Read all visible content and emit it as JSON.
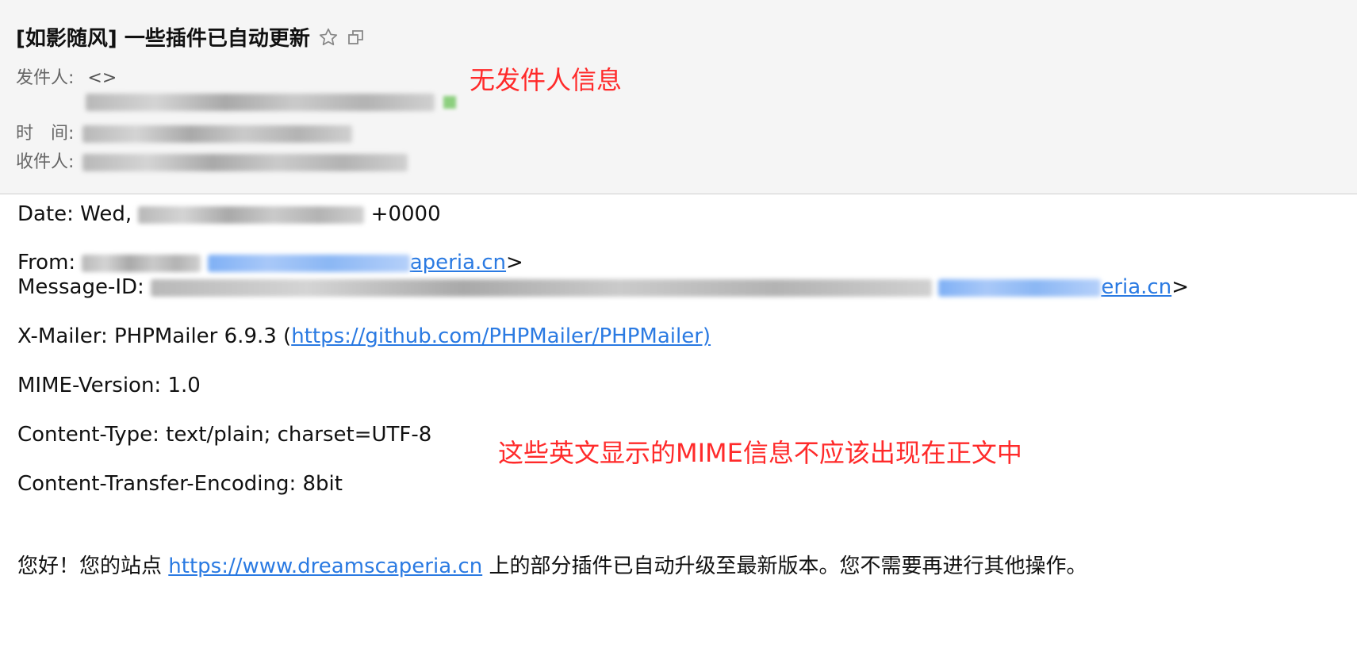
{
  "header": {
    "subject": "[如影随风] 一些插件已自动更新",
    "from_label": "发件人:",
    "from_value": "<>",
    "time_label": "时　间:",
    "to_label": "收件人:"
  },
  "annotations": {
    "no_sender": "无发件人信息",
    "mime_note": "这些英文显示的MIME信息不应该出现在正文中"
  },
  "body": {
    "date_prefix": "Date: Wed,",
    "date_suffix": "+0000",
    "from_prefix": "From:",
    "from_link_tail": "aperia.cn",
    "from_suffix": ">",
    "msgid_prefix": "Message-ID:",
    "msgid_link_tail": "eria.cn",
    "msgid_suffix": ">",
    "xmailer_prefix": "X-Mailer: PHPMailer 6.9.3 (",
    "xmailer_link": "https://github.com/PHPMailer/PHPMailer)",
    "mime_version": "MIME-Version: 1.0",
    "content_type": "Content-Type: text/plain; charset=UTF-8",
    "content_transfer": "Content-Transfer-Encoding: 8bit",
    "greeting_prefix": "您好！您的站点",
    "site_link": "https://www.dreamscaperia.cn",
    "greeting_suffix": "上的部分插件已自动升级至最新版本。您不需要再进行其他操作。"
  },
  "colors": {
    "link": "#2a7ae2",
    "annotation": "#ff2a2a",
    "header_bg": "#f5f5f5"
  },
  "icons": [
    "star-icon",
    "popout-window-icon"
  ]
}
